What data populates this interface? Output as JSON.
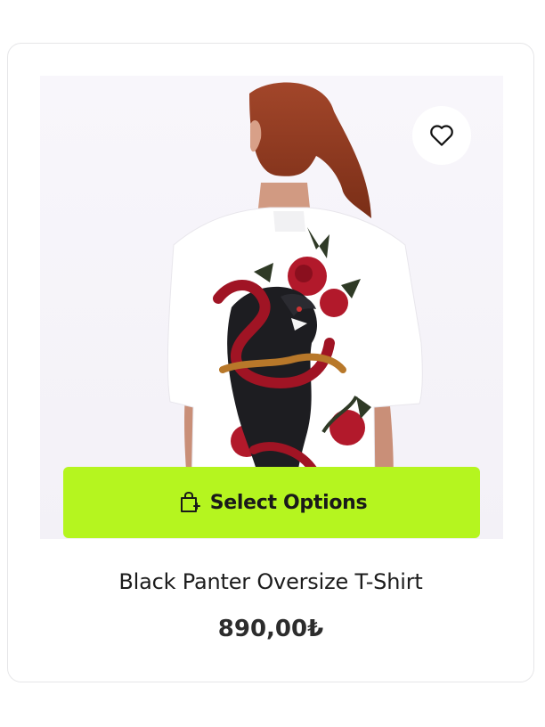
{
  "product": {
    "title": "Black Panter Oversize T-Shirt",
    "price": "890,00₺",
    "select_label": "Select Options",
    "image_icon": "product-photo"
  },
  "icons": {
    "wishlist": "heart-icon",
    "select": "shopping-bag-plus-icon"
  },
  "colors": {
    "accent": "#b5f51f",
    "card_border": "#e6e6e8",
    "text": "#1c1c1c"
  }
}
